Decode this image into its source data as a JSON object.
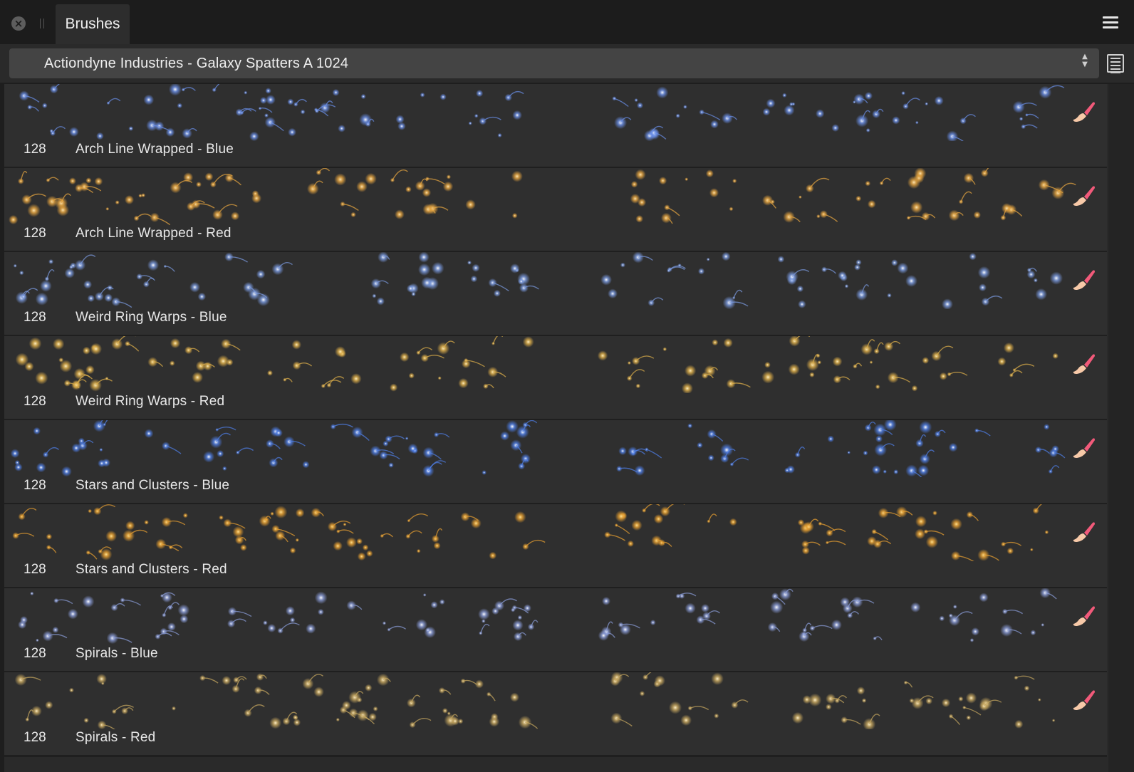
{
  "header": {
    "close_icon": "close-circle-icon",
    "tab_label": "Brushes",
    "menu_icon": "hamburger-menu-icon"
  },
  "category": {
    "selected": "Actiondyne Industries - Galaxy Spatters A 1024",
    "view_icon": "list-view-icon"
  },
  "brushes": [
    {
      "count": "128",
      "name": "Arch Line Wrapped - Blue",
      "tint": "#6a8fe8",
      "accent": "#ffffff"
    },
    {
      "count": "128",
      "name": "Arch Line Wrapped - Red",
      "tint": "#e8a640",
      "accent": "#ffe6b0"
    },
    {
      "count": "128",
      "name": "Weird Ring Warps - Blue",
      "tint": "#7a9ae0",
      "accent": "#ffffff"
    },
    {
      "count": "128",
      "name": "Weird Ring Warps - Red",
      "tint": "#e0b04a",
      "accent": "#fff0c0"
    },
    {
      "count": "128",
      "name": "Stars and Clusters - Blue",
      "tint": "#4f7fe8",
      "accent": "#ffffff"
    },
    {
      "count": "128",
      "name": "Stars and Clusters - Red",
      "tint": "#e8a030",
      "accent": "#ffe090"
    },
    {
      "count": "128",
      "name": "Spirals - Blue",
      "tint": "#8a9cd8",
      "accent": "#ffffff"
    },
    {
      "count": "128",
      "name": "Spirals - Red",
      "tint": "#c8a860",
      "accent": "#fff0c8"
    }
  ],
  "colors": {
    "brush_icon_tip": "#f25a7a",
    "brush_icon_handle": "#f7c9a8"
  }
}
